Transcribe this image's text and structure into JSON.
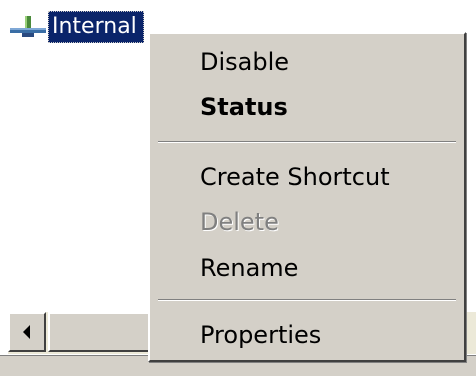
{
  "network": {
    "icon": "network-connection-icon",
    "label": "Internal"
  },
  "context_menu": {
    "items": [
      {
        "label": "Disable",
        "enabled": true,
        "default": false
      },
      {
        "label": "Status",
        "enabled": true,
        "default": true
      },
      {
        "label": "Create Shortcut",
        "enabled": true,
        "default": false
      },
      {
        "label": "Delete",
        "enabled": false,
        "default": false
      },
      {
        "label": "Rename",
        "enabled": true,
        "default": false
      },
      {
        "label": "Properties",
        "enabled": true,
        "default": false
      }
    ]
  },
  "scrollbar": {
    "left_icon": "scroll-left-arrow-icon"
  },
  "colors": {
    "selection": "#0a246a",
    "menu_background": "#d4d0c8",
    "disabled_text": "#808080"
  }
}
